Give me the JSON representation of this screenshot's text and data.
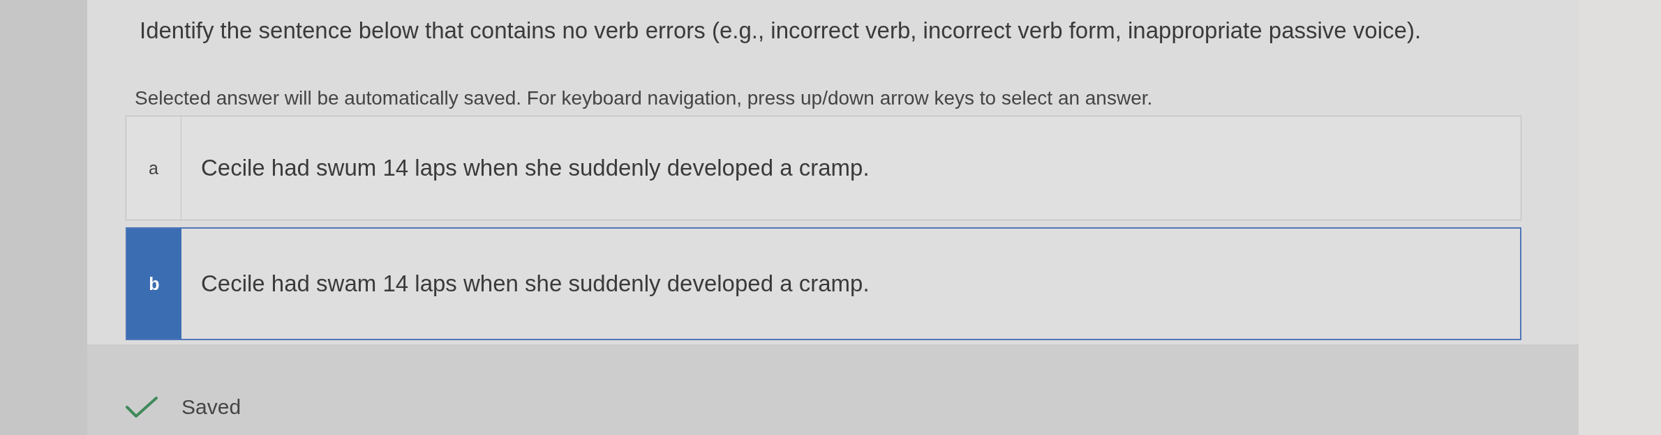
{
  "question": {
    "prompt": "Identify the sentence below that contains no verb errors (e.g., incorrect verb, incorrect verb form, inappropriate passive voice).",
    "instructions": "Selected answer will be automatically saved. For keyboard navigation, press up/down arrow keys to select an answer."
  },
  "options": [
    {
      "letter": "a",
      "text": "Cecile had swum 14 laps when she suddenly developed a cramp.",
      "selected": false
    },
    {
      "letter": "b",
      "text": "Cecile had swam 14 laps when she suddenly developed a cramp.",
      "selected": true
    }
  ],
  "status": {
    "label": "Saved"
  }
}
